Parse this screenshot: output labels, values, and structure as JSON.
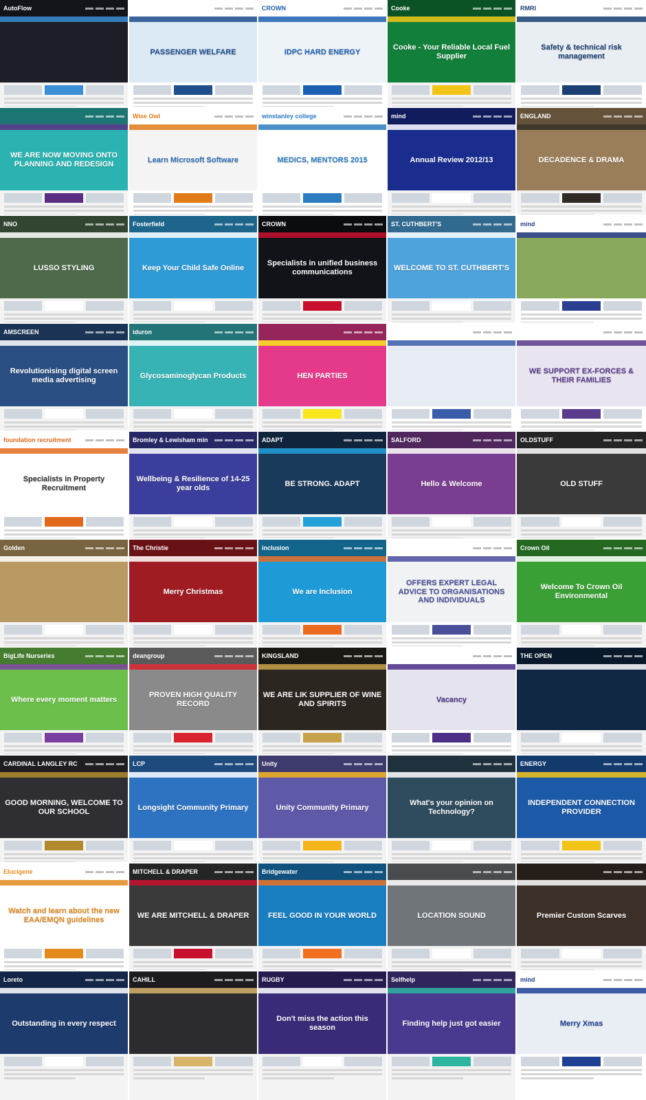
{
  "tiles": [
    {
      "logo": "AutoFlow",
      "hero": "",
      "bg": "#1c1f27",
      "accent": "#3b8fd6",
      "text": "#ffffff",
      "dark": true
    },
    {
      "logo": "",
      "hero": "PASSENGER WELFARE",
      "bg": "#dbeaf5",
      "accent": "#1f4e8c",
      "text": "#1f4e8c",
      "dark": false
    },
    {
      "logo": "CROWN",
      "hero": "IDPC HARD ENERGY",
      "bg": "#eef3f7",
      "accent": "#1d5fb3",
      "text": "#1d5fb3",
      "dark": false
    },
    {
      "logo": "Cooke",
      "hero": "Cooke - Your Reliable Local Fuel Supplier",
      "bg": "#12803a",
      "accent": "#f2c417",
      "text": "#ffffff",
      "dark": true
    },
    {
      "logo": "RMRI",
      "hero": "Safety & technical risk management",
      "bg": "#e9eef2",
      "accent": "#1b3f73",
      "text": "#1b3f73",
      "dark": false
    },
    {
      "logo": "",
      "hero": "WE ARE NOW MOVING ONTO PLANNING AND REDESIGN",
      "bg": "#2bb3b1",
      "accent": "#5a2d82",
      "text": "#ffffff",
      "dark": true
    },
    {
      "logo": "Wise Owl",
      "hero": "Learn Microsoft Software",
      "bg": "#f4f4f4",
      "accent": "#e07b18",
      "text": "#2e6fb7",
      "dark": false
    },
    {
      "logo": "winstanley college",
      "hero": "MEDICS, MENTORS 2015",
      "bg": "#ffffff",
      "accent": "#2c7cc1",
      "text": "#2c7cc1",
      "dark": false
    },
    {
      "logo": "mind",
      "hero": "Annual Review 2012/13",
      "bg": "#1a2c8e",
      "accent": "#ffffff",
      "text": "#ffffff",
      "dark": true
    },
    {
      "logo": "ENGLAND",
      "hero": "DECADENCE & DRAMA",
      "bg": "#9a7e5a",
      "accent": "#2f2a24",
      "text": "#ffffff",
      "dark": true
    },
    {
      "logo": "NNO",
      "hero": "LUSSO STYLING",
      "bg": "#4e6a4a",
      "accent": "#ffffff",
      "text": "#ffffff",
      "dark": true
    },
    {
      "logo": "Fosterfield",
      "hero": "Keep Your Child Safe Online",
      "bg": "#2e9bd6",
      "accent": "#ffffff",
      "text": "#ffffff",
      "dark": true
    },
    {
      "logo": "CROWN",
      "hero": "Specialists in unified business communications",
      "bg": "#111319",
      "accent": "#c8102e",
      "text": "#ffffff",
      "dark": true
    },
    {
      "logo": "ST. CUTHBERT'S",
      "hero": "WELCOME TO ST. CUTHBERT'S",
      "bg": "#4ea3dc",
      "accent": "#ffffff",
      "text": "#ffffff",
      "dark": true
    },
    {
      "logo": "mind",
      "hero": "",
      "bg": "#8aa85c",
      "accent": "#2a3f8f",
      "text": "#2a3f8f",
      "dark": false
    },
    {
      "logo": "AMSCREEN",
      "hero": "Revolutionising digital screen media advertising",
      "bg": "#2a4f82",
      "accent": "#ffffff",
      "text": "#ffffff",
      "dark": true
    },
    {
      "logo": "iduron",
      "hero": "Glycosaminoglycan Products",
      "bg": "#37b3b6",
      "accent": "#ffffff",
      "text": "#ffffff",
      "dark": true
    },
    {
      "logo": "",
      "hero": "HEN PARTIES",
      "bg": "#e53a8b",
      "accent": "#f8e71c",
      "text": "#ffffff",
      "dark": true
    },
    {
      "logo": "",
      "hero": "",
      "bg": "#e7ecf4",
      "accent": "#3a5da8",
      "text": "#3a5da8",
      "dark": false
    },
    {
      "logo": "",
      "hero": "WE SUPPORT EX-FORCES & THEIR FAMILIES",
      "bg": "#e8e4f0",
      "accent": "#5b3b8c",
      "text": "#5b3b8c",
      "dark": false
    },
    {
      "logo": "foundation recruitment",
      "hero": "Specialists in Property Recruitment",
      "bg": "#ffffff",
      "accent": "#e06a1c",
      "text": "#333333",
      "dark": false
    },
    {
      "logo": "Bromley & Lewisham mind",
      "hero": "Wellbeing & Resilience of 14-25 year olds",
      "bg": "#3b3e9c",
      "accent": "#ffffff",
      "text": "#ffffff",
      "dark": true
    },
    {
      "logo": "ADAPT",
      "hero": "BE STRONG. ADAPT",
      "bg": "#1a3a5c",
      "accent": "#23a0d8",
      "text": "#ffffff",
      "dark": true
    },
    {
      "logo": "SALFORD",
      "hero": "Hello & Welcome",
      "bg": "#7a3d8f",
      "accent": "#ffffff",
      "text": "#ffffff",
      "dark": true
    },
    {
      "logo": "OLDSTUFF",
      "hero": "OLD STUFF",
      "bg": "#3a3a3a",
      "accent": "#ffffff",
      "text": "#ffffff",
      "dark": true
    },
    {
      "logo": "Golden",
      "hero": "",
      "bg": "#b99a63",
      "accent": "#ffffff",
      "text": "#ffffff",
      "dark": true
    },
    {
      "logo": "The Christie",
      "hero": "Merry Christmas",
      "bg": "#a01c23",
      "accent": "#ffffff",
      "text": "#ffffff",
      "dark": true
    },
    {
      "logo": "inclusion",
      "hero": "We are Inclusion",
      "bg": "#1e9ad6",
      "accent": "#ea6a20",
      "text": "#ffffff",
      "dark": true
    },
    {
      "logo": "",
      "hero": "OFFERS EXPERT LEGAL ADVICE TO ORGANISATIONS AND INDIVIDUALS",
      "bg": "#f1f2f4",
      "accent": "#4a4f9a",
      "text": "#4a4f9a",
      "dark": false
    },
    {
      "logo": "Crown Oil",
      "hero": "Welcome To Crown Oil Environmental",
      "bg": "#3aa035",
      "accent": "#ffffff",
      "text": "#ffffff",
      "dark": true
    },
    {
      "logo": "BigLife Nurseries",
      "hero": "Where every moment matters",
      "bg": "#6bbf4a",
      "accent": "#7a3fa0",
      "text": "#ffffff",
      "dark": true
    },
    {
      "logo": "deangroup",
      "hero": "PROVEN HIGH QUALITY RECORD",
      "bg": "#8a8a8a",
      "accent": "#d9232e",
      "text": "#ffffff",
      "dark": true
    },
    {
      "logo": "KINGSLAND",
      "hero": "WE ARE LIK SUPPLIER OF WINE AND SPIRITS",
      "bg": "#2c2620",
      "accent": "#c8a24a",
      "text": "#ffffff",
      "dark": true
    },
    {
      "logo": "",
      "hero": "Vacancy",
      "bg": "#e5e3ee",
      "accent": "#4c2f87",
      "text": "#4c2f87",
      "dark": false
    },
    {
      "logo": "THE OPEN",
      "hero": "",
      "bg": "#0f2743",
      "accent": "#ffffff",
      "text": "#ffffff",
      "dark": true
    },
    {
      "logo": "CARDINAL LANGLEY RC HIGH SCHOOL",
      "hero": "GOOD MORNING, WELCOME TO OUR SCHOOL",
      "bg": "#2f2f33",
      "accent": "#b08a2c",
      "text": "#ffffff",
      "dark": true
    },
    {
      "logo": "LCP",
      "hero": "Longsight Community Primary",
      "bg": "#2e73c2",
      "accent": "#ffffff",
      "text": "#ffffff",
      "dark": true
    },
    {
      "logo": "Unity",
      "hero": "Unity Community Primary",
      "bg": "#5e5aa8",
      "accent": "#f4b41a",
      "text": "#ffffff",
      "dark": true
    },
    {
      "logo": "",
      "hero": "What's your opinion on Technology?",
      "bg": "#2f4c5e",
      "accent": "#ffffff",
      "text": "#ffffff",
      "dark": true
    },
    {
      "logo": "ENERGY",
      "hero": "INDEPENDENT CONNECTION PROVIDER",
      "bg": "#1c5aa8",
      "accent": "#f2c417",
      "text": "#ffffff",
      "dark": true
    },
    {
      "logo": "Elucigene",
      "hero": "Watch and learn about the new EAA/EMQN guidelines",
      "bg": "#ffffff",
      "accent": "#e38a1d",
      "text": "#e38a1d",
      "dark": false
    },
    {
      "logo": "MITCHELL & DRAPER",
      "hero": "WE ARE MITCHELL & DRAPER",
      "bg": "#3a3a3a",
      "accent": "#c8102e",
      "text": "#ffffff",
      "dark": true
    },
    {
      "logo": "Bridgewater",
      "hero": "FEEL GOOD IN YOUR WORLD",
      "bg": "#1a7fc1",
      "accent": "#f07020",
      "text": "#ffffff",
      "dark": true
    },
    {
      "logo": "",
      "hero": "LOCATION SOUND",
      "bg": "#70757a",
      "accent": "#ffffff",
      "text": "#ffffff",
      "dark": true
    },
    {
      "logo": "",
      "hero": "Premier Custom Scarves",
      "bg": "#3b2f27",
      "accent": "#ffffff",
      "text": "#ffffff",
      "dark": true
    },
    {
      "logo": "Loreto",
      "hero": "Outstanding in every respect",
      "bg": "#1e3b6e",
      "accent": "#ffffff",
      "text": "#ffffff",
      "dark": true
    },
    {
      "logo": "CAHILL",
      "hero": "",
      "bg": "#2c2c30",
      "accent": "#d7b46a",
      "text": "#ffffff",
      "dark": true
    },
    {
      "logo": "RUGBY",
      "hero": "Don't miss the action this season",
      "bg": "#3b2a78",
      "accent": "#ffffff",
      "text": "#ffffff",
      "dark": true
    },
    {
      "logo": "Selfhelp",
      "hero": "Finding help just got easier",
      "bg": "#4a3a8f",
      "accent": "#2db5a0",
      "text": "#ffffff",
      "dark": true
    },
    {
      "logo": "mind",
      "hero": "Merry Xmas",
      "bg": "#e9eef5",
      "accent": "#1f3f93",
      "text": "#1f3f93",
      "dark": false
    }
  ]
}
